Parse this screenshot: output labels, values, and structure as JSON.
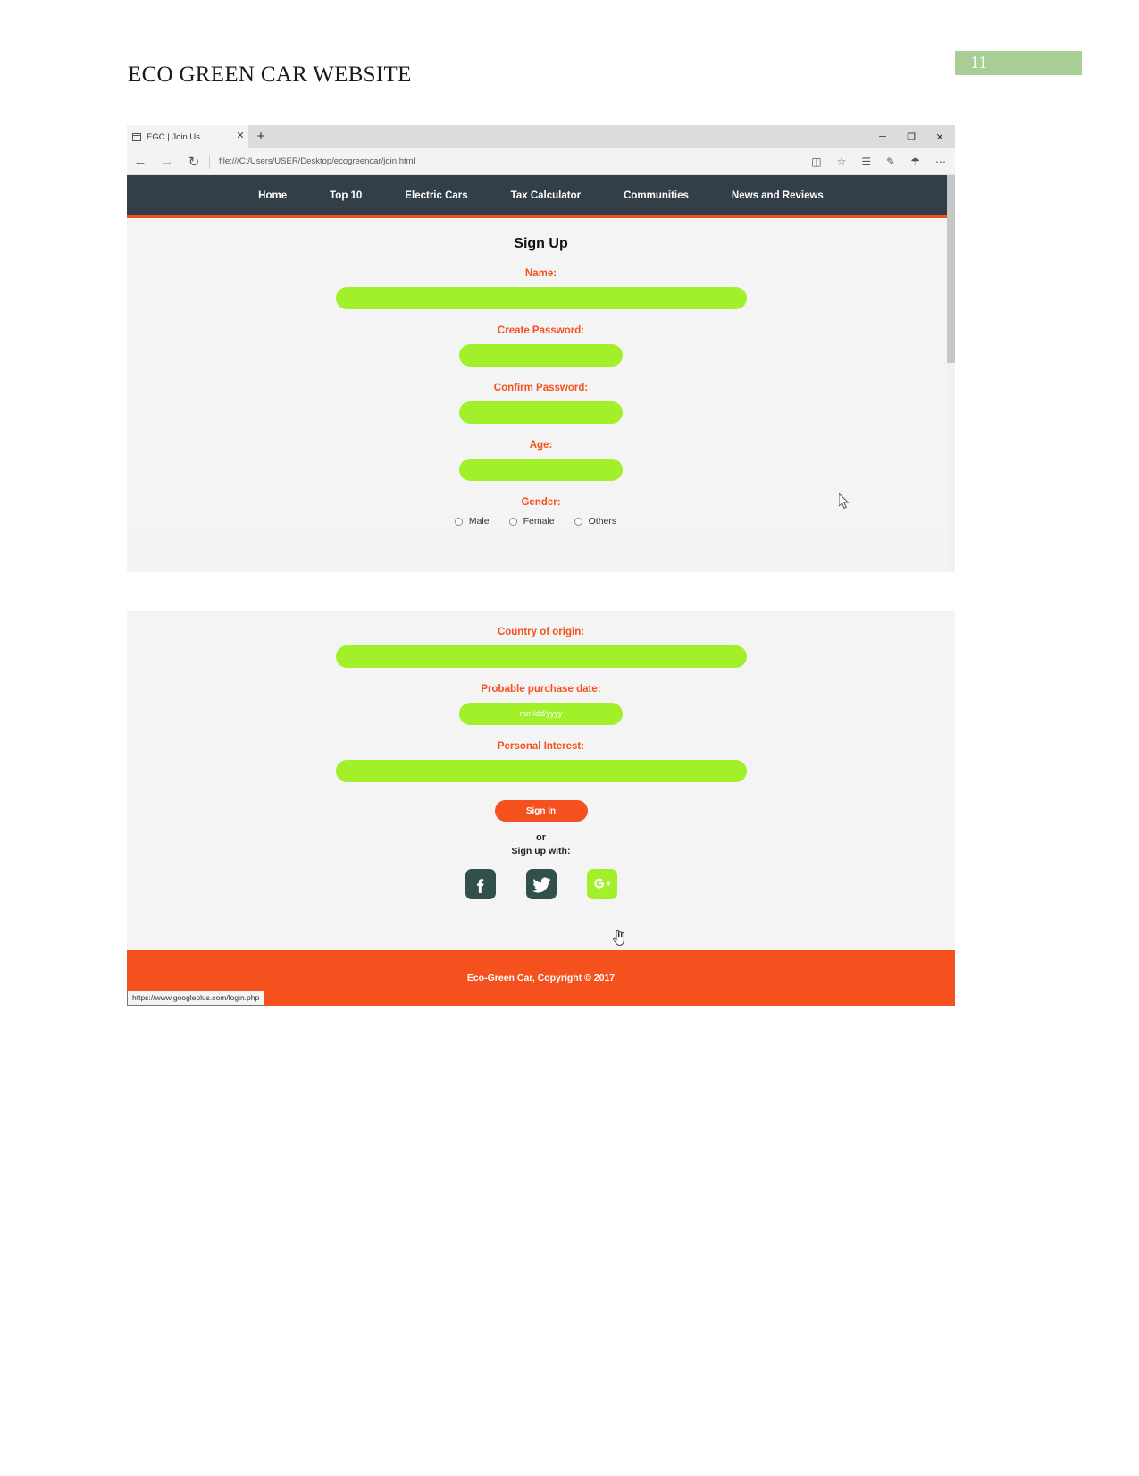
{
  "document": {
    "title": "ECO GREEN CAR WEBSITE",
    "page_number": "11",
    "badge_color": "#a8ce96"
  },
  "browser": {
    "tab": {
      "title": "EGC | Join Us",
      "close_label": "✕",
      "newtab_label": "+"
    },
    "window_controls": {
      "minimize": "─",
      "maximize": "❐",
      "close": "✕"
    },
    "toolbar": {
      "back": "←",
      "forward": "→",
      "refresh": "↻",
      "reading_view": "◫",
      "favorite": "☆",
      "hub": "☰",
      "notes": "✎",
      "share": "☂",
      "more": "⋯"
    },
    "url": "file:///C:/Users/USER/Desktop/ecogreencar/join.html",
    "status_url": "https://www.googleplus.com/login.php"
  },
  "site": {
    "nav": [
      {
        "label": "Home"
      },
      {
        "label": "Top 10"
      },
      {
        "label": "Electric Cars"
      },
      {
        "label": "Tax Calculator"
      },
      {
        "label": "Communities"
      },
      {
        "label": "News and Reviews"
      }
    ],
    "nav_bg": "#333f48",
    "accent": "#f4511e",
    "field_green": "#a2f029"
  },
  "form": {
    "heading": "Sign Up",
    "fields": [
      {
        "label": "Name:",
        "value": ""
      },
      {
        "label": "Create Password:",
        "value": ""
      },
      {
        "label": "Confirm Password:",
        "value": ""
      },
      {
        "label": "Age:",
        "value": ""
      }
    ],
    "gender": {
      "label": "Gender:",
      "options": [
        {
          "label": "Male"
        },
        {
          "label": "Female"
        },
        {
          "label": "Others"
        }
      ]
    },
    "country": {
      "label": "Country of origin:",
      "value": ""
    },
    "purchase_date": {
      "label": "Probable purchase date:",
      "placeholder": "mm/dd/yyyy",
      "value": ""
    },
    "interest": {
      "label": "Personal Interest:",
      "value": ""
    },
    "submit_label": "Sign In",
    "or_label": "or",
    "signup_with_label": "Sign up with:",
    "socials": [
      {
        "name": "facebook",
        "label": "Facebook"
      },
      {
        "name": "twitter",
        "label": "Twitter"
      },
      {
        "name": "googleplus",
        "label": "Google Plus"
      }
    ]
  },
  "footer": {
    "text": "Eco-Green Car, Copyright © 2017"
  }
}
